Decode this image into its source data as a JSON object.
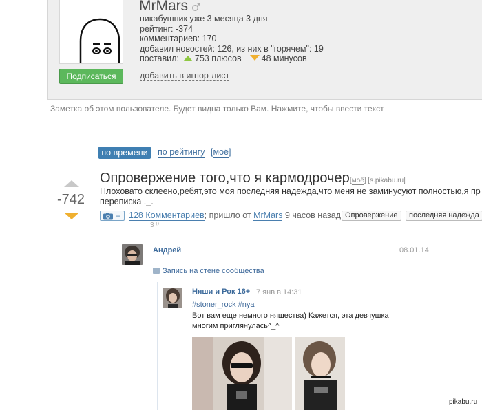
{
  "profile": {
    "username": "MrMars",
    "subscribe_label": "Подписаться",
    "stats": {
      "member_for": "пикабушник уже 3 месяца 3 дня",
      "rating": "рейтинг: -374",
      "comments": "комментариев: 170",
      "news": "добавил новостей: 126, из них в \"горячем\": 19",
      "gave_prefix": "поставил:",
      "pluses": "753 плюсов",
      "minuses": "48 минусов"
    },
    "ignore_label": "добавить в игнор-лист",
    "note_placeholder": "Заметка об этом пользователе. Будет видна только Вам. Нажмите, чтобы ввести текст"
  },
  "sort": {
    "by_time": "по времени",
    "by_rating": "по рейтингу",
    "mine": "моё"
  },
  "post": {
    "score": "-742",
    "title": "Опровержение того,что я кармодрочер",
    "title_mine": "моё",
    "title_source": "[s.pikabu.ru]",
    "text_line1": "Плоховато склеено,ребят,это моя последняя надежда,что меня не заминусуют полностью,я пр",
    "text_line2": "переписка ._.",
    "camera_dash": "–",
    "comments_link": "128 Комментариев",
    "posted_prefix": "; пришло от",
    "author": "MrMars",
    "posted_suffix": "9 часов назад",
    "tags": [
      "Опровержение",
      "последняя надежда"
    ]
  },
  "screenshot": {
    "cut_text": "3 ⁽⁾",
    "comment_author": "Андрей",
    "comment_date": "08.01.14",
    "wall_label": "Запись на стене сообщества",
    "group_name": "Няши и Рок 16+",
    "group_date": "7 янв в 14:31",
    "hashtags": "#stoner_rock #nya",
    "text_line1": "Вот вам еще немного няшества) Кажется, эта девчушка",
    "text_line2": "многим приглянулась^_^"
  },
  "watermark": "pikabu.ru",
  "colors": {
    "accent": "#3f7fb2",
    "subscribe": "#5cb85c",
    "plus": "#8fc843",
    "minus": "#f0b030"
  }
}
